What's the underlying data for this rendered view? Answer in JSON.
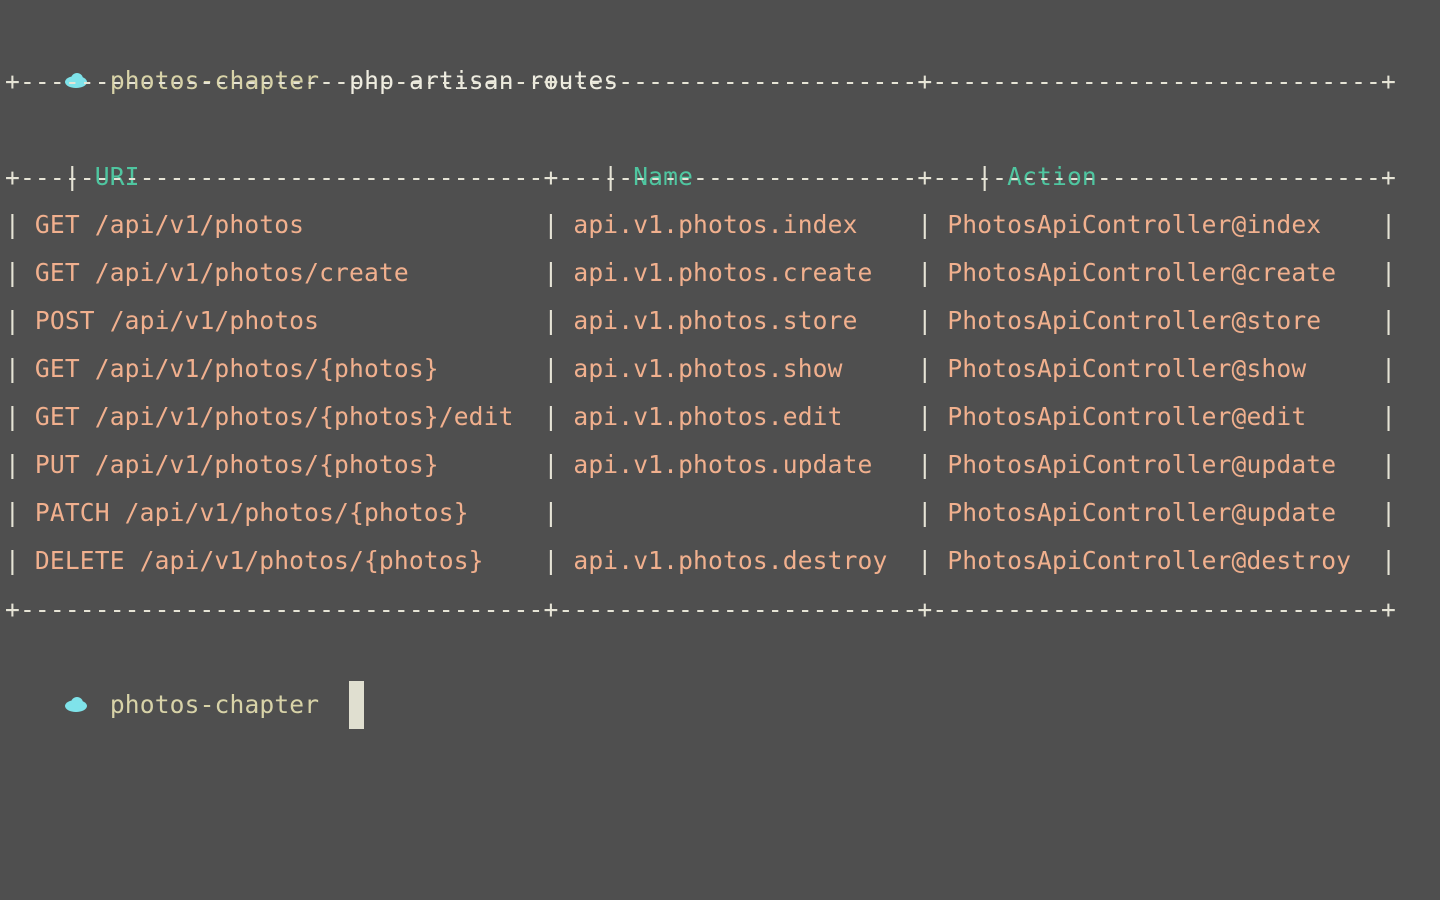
{
  "prompt": {
    "directory": "photos-chapter",
    "command": "php artisan routes",
    "icon": "cloud-icon"
  },
  "table": {
    "columns": [
      "URI",
      "Name",
      "Action"
    ],
    "column_widths_chars": [
      34,
      23,
      29
    ],
    "rows": [
      {
        "uri": "GET /api/v1/photos",
        "name": "api.v1.photos.index",
        "action": "PhotosApiController@index"
      },
      {
        "uri": "GET /api/v1/photos/create",
        "name": "api.v1.photos.create",
        "action": "PhotosApiController@create"
      },
      {
        "uri": "POST /api/v1/photos",
        "name": "api.v1.photos.store",
        "action": "PhotosApiController@store"
      },
      {
        "uri": "GET /api/v1/photos/{photos}",
        "name": "api.v1.photos.show",
        "action": "PhotosApiController@show"
      },
      {
        "uri": "GET /api/v1/photos/{photos}/edit",
        "name": "api.v1.photos.edit",
        "action": "PhotosApiController@edit"
      },
      {
        "uri": "PUT /api/v1/photos/{photos}",
        "name": "api.v1.photos.update",
        "action": "PhotosApiController@update"
      },
      {
        "uri": "PATCH /api/v1/photos/{photos}",
        "name": "",
        "action": "PhotosApiController@update"
      },
      {
        "uri": "DELETE /api/v1/photos/{photos}",
        "name": "api.v1.photos.destroy",
        "action": "PhotosApiController@destroy"
      }
    ]
  },
  "next_prompt": {
    "directory": "photos-chapter",
    "input": ""
  },
  "colors": {
    "background": "#4f4f4f",
    "header": "#4fc6a0",
    "cell": "#f1b08e",
    "border": "#e6e4d6",
    "prompt_dir": "#d8d3a8",
    "cloud": "#7fe3ea"
  }
}
